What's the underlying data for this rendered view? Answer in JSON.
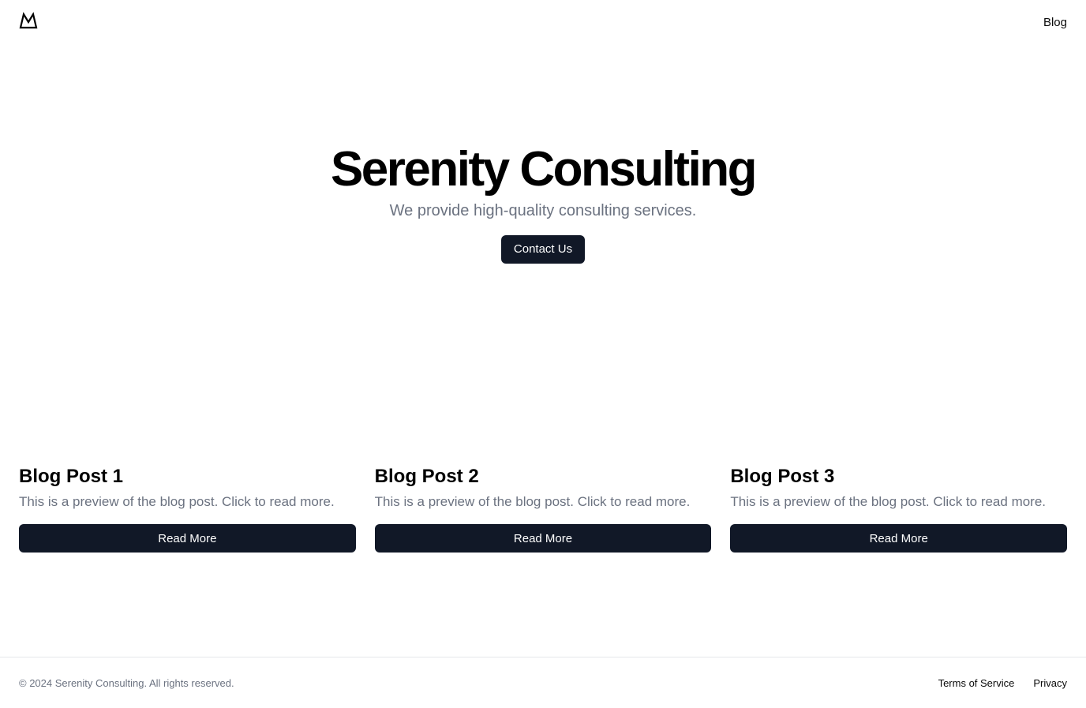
{
  "header": {
    "logo_icon": "mountain-icon",
    "nav": [
      {
        "label": "Blog"
      }
    ]
  },
  "hero": {
    "title": "Serenity Consulting",
    "subtitle": "We provide high-quality consulting services.",
    "cta_label": "Contact Us"
  },
  "posts": [
    {
      "title": "Blog Post 1",
      "preview": "This is a preview of the blog post. Click to read more.",
      "button_label": "Read More"
    },
    {
      "title": "Blog Post 2",
      "preview": "This is a preview of the blog post. Click to read more.",
      "button_label": "Read More"
    },
    {
      "title": "Blog Post 3",
      "preview": "This is a preview of the blog post. Click to read more.",
      "button_label": "Read More"
    }
  ],
  "footer": {
    "copyright": "© 2024 Serenity Consulting. All rights reserved.",
    "links": [
      {
        "label": "Terms of Service"
      },
      {
        "label": "Privacy"
      }
    ]
  },
  "colors": {
    "button_bg": "#111827",
    "muted_text": "#6b7280",
    "border": "#e5e7eb"
  }
}
